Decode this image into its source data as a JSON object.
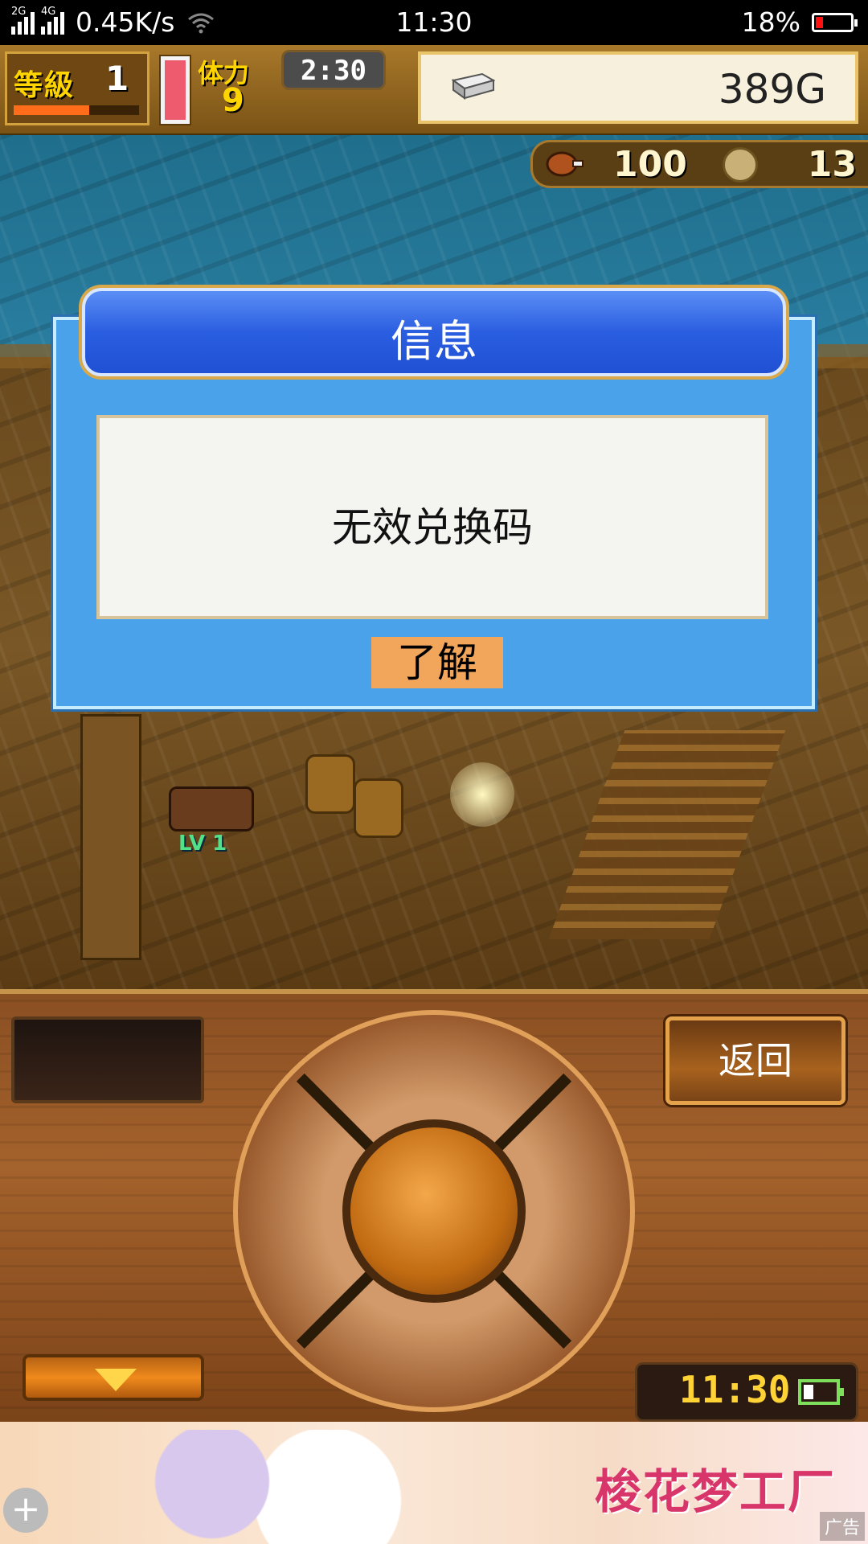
{
  "status_bar": {
    "network_1": "2G",
    "network_2": "4G",
    "speed": "0.45K/s",
    "time": "11:30",
    "battery": "18%",
    "battery_color": "#ff1111"
  },
  "hud": {
    "level_label": "等級",
    "level_value": "1",
    "stamina_label": "体力",
    "stamina_value": "9",
    "timer": "2:30",
    "gold": "389G"
  },
  "resources": {
    "food": "100",
    "coins": "13"
  },
  "scene": {
    "npc_level": "LV 1"
  },
  "dialog": {
    "title": "信息",
    "message": "无效兑换码",
    "ok_label": "了解"
  },
  "controls": {
    "back_label": "返回",
    "clock": "11:30"
  },
  "ad": {
    "logo": "梭花梦工厂",
    "tag": "广告",
    "close_symbol": "+"
  },
  "colors": {
    "dialog_blue": "#4aa3ea",
    "dialog_header": "#2a5ee0",
    "ok_button": "#f2a65c",
    "hud_gold": "#ffd500"
  }
}
